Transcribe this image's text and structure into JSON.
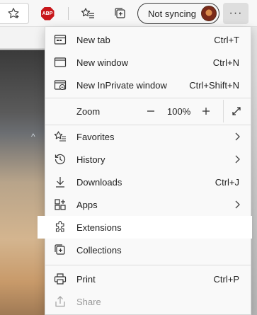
{
  "toolbar": {
    "favorite_icon": "star-icon",
    "adblock_label": "ABP",
    "sync_label": "Not syncing",
    "more_label": "···"
  },
  "menu": {
    "items": [
      {
        "label": "New tab",
        "shortcut": "Ctrl+T",
        "icon": "new-tab-icon"
      },
      {
        "label": "New window",
        "shortcut": "Ctrl+N",
        "icon": "new-window-icon"
      },
      {
        "label": "New InPrivate window",
        "shortcut": "Ctrl+Shift+N",
        "icon": "inprivate-icon"
      },
      {
        "label": "Favorites",
        "icon": "favorites-icon"
      },
      {
        "label": "History",
        "icon": "history-icon"
      },
      {
        "label": "Downloads",
        "shortcut": "Ctrl+J",
        "icon": "download-icon"
      },
      {
        "label": "Apps",
        "icon": "apps-icon"
      },
      {
        "label": "Extensions",
        "icon": "extensions-icon",
        "highlighted": true
      },
      {
        "label": "Collections",
        "icon": "collections-icon"
      },
      {
        "label": "Print",
        "shortcut": "Ctrl+P",
        "icon": "print-icon"
      },
      {
        "label": "Share",
        "icon": "share-icon",
        "disabled": true
      }
    ],
    "zoom": {
      "label": "Zoom",
      "minus": "−",
      "value": "100%",
      "plus": "+"
    }
  },
  "colors": {
    "menu_bg": "#f9f9f9",
    "highlight_bg": "#ffffff",
    "adblock_red": "#c8171b"
  }
}
